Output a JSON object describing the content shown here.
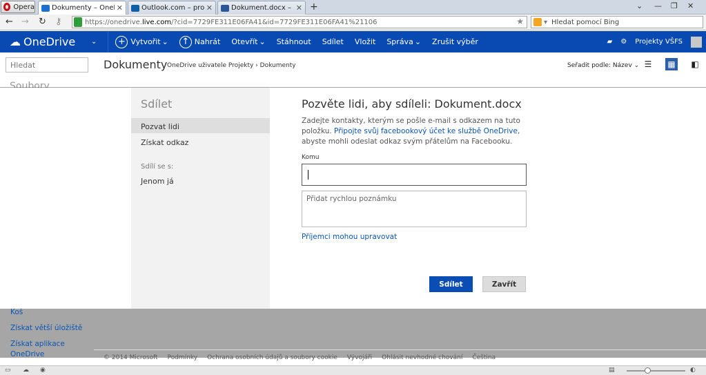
{
  "browser": {
    "opera_label": "Opera",
    "tabs": [
      {
        "label": "Dokumenty – OneDrive"
      },
      {
        "label": "Outlook.com – projekt..."
      },
      {
        "label": "Dokument.docx – Micr..."
      }
    ],
    "newtab_icon": "+",
    "url_prefix": "https://onedrive.",
    "url_domain": "live.com",
    "url_rest": "/?cid=7729FE311E06FA41&id=7729FE311E06FA41%21106",
    "search_placeholder": "Hledat pomocí Bing"
  },
  "onedrive": {
    "logo": "OneDrive",
    "commands": [
      {
        "label": "Vytvořit",
        "icon": "plus-circle-icon",
        "dropdown": true
      },
      {
        "label": "Nahrát",
        "icon": "upload-icon",
        "dropdown": false
      },
      {
        "label": "Otevřít",
        "dropdown": true
      },
      {
        "label": "Stáhnout",
        "dropdown": false
      },
      {
        "label": "Sdílet",
        "dropdown": false
      },
      {
        "label": "Vložit",
        "dropdown": false
      },
      {
        "label": "Správa",
        "dropdown": true
      },
      {
        "label": "Zrušit výběr",
        "dropdown": false
      }
    ],
    "user": "Projekty VŠFS",
    "search_placeholder": "Hledat",
    "page_title": "Dokumenty",
    "breadcrumb_root": "OneDrive uživatele Projekty",
    "breadcrumb_current": "Dokumenty",
    "sort_label": "Seřadit podle: Název",
    "side_peek": "Soubory",
    "side_links": [
      "Koš",
      "Získat větší úložiště",
      "Získat aplikace OneDrive"
    ]
  },
  "dialog": {
    "title": "Sdílet",
    "options": [
      {
        "label": "Pozvat lidi",
        "selected": true
      },
      {
        "label": "Získat odkaz",
        "selected": false
      }
    ],
    "shared_with_label": "Sdílí se s:",
    "shared_with_value": "Jenom já",
    "heading": "Pozvěte lidi, aby sdíleli: Dokument.docx",
    "desc_1": "Zadejte kontakty, kterým se pošle e-mail s odkazem na tuto položku.",
    "desc_link": "Připojte svůj facebookový účet ke službě OneDrive",
    "desc_2": ", abyste mohli odeslat odkaz svým přátelům na Facebooku.",
    "to_label": "Komu",
    "to_value": "",
    "note_placeholder": "Přidat rychlou poznámku",
    "permission_link": "Příjemci mohou upravovat",
    "share_button": "Sdílet",
    "close_button": "Zavřít"
  },
  "footer": {
    "items": [
      "© 2014 Microsoft",
      "Podmínky",
      "Ochrana osobních údajů a soubory cookie",
      "Vývojáři",
      "Ohlásit nevhodné chování",
      "Čeština"
    ]
  },
  "colors": {
    "brand": "#094ab2",
    "primary_button": "#0a4db5",
    "link": "#0a55b4"
  }
}
